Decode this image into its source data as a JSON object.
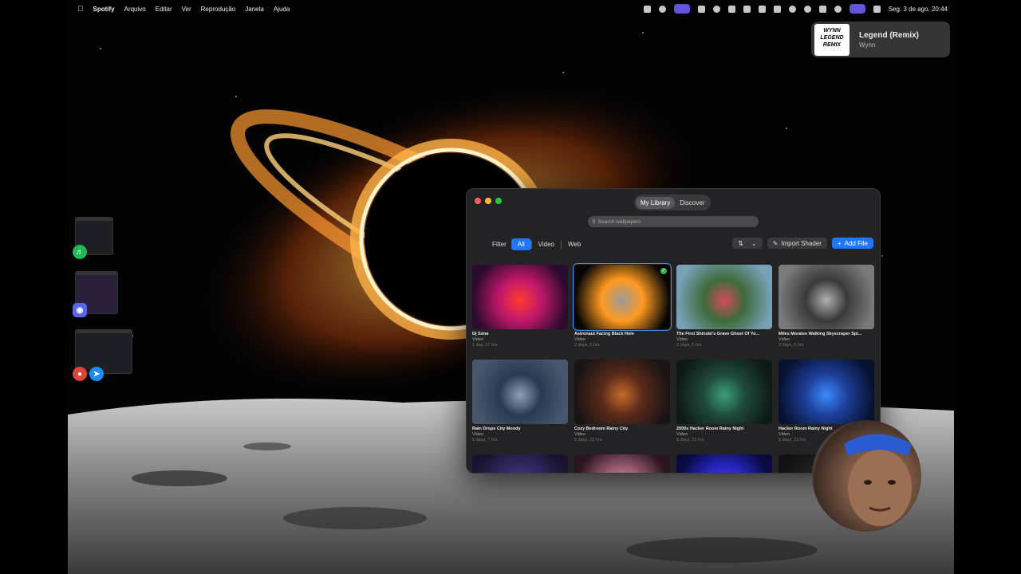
{
  "menubar": {
    "app_name": "Spotify",
    "menus": [
      "Arquivo",
      "Editar",
      "Ver",
      "Reprodução",
      "Janela",
      "Ajuda"
    ],
    "datetime": "Seg. 3 de ago.  20:44"
  },
  "now_playing": {
    "art_text": "WYNN LEGEND REMIX",
    "title": "Legend (Remix)",
    "artist": "Wynn"
  },
  "window": {
    "tabs": [
      "My Library",
      "Discover"
    ],
    "active_tab": "My Library",
    "search_placeholder": "Search wallpapers",
    "filter_label": "Filter",
    "filters": [
      "All",
      "Video",
      "Web"
    ],
    "active_filter": "All",
    "import_label": "Import Shader",
    "add_label": "Add File",
    "cards": [
      {
        "title": "Dj Sona",
        "type": "Video",
        "date": "1 day, 17 hrs",
        "colors": [
          "#2a0a2e",
          "#c2186b",
          "#ff3b2f"
        ]
      },
      {
        "title": "Astronaut Facing Black Hole",
        "type": "Video",
        "date": "2 days, 5 hrs",
        "selected": true,
        "colors": [
          "#050505",
          "#ff9a20",
          "#9a9a9a"
        ]
      },
      {
        "title": "The First Shinobi's Grave Ghost Of Yo...",
        "type": "Video",
        "date": "2 days, 5 hrs",
        "colors": [
          "#7aa0b8",
          "#3e6b3a",
          "#d24b5a"
        ]
      },
      {
        "title": "Miles Morales Walking Skyscraper Spi...",
        "type": "Video",
        "date": "2 days, 5 hrs",
        "colors": [
          "#7a7a7a",
          "#3a3a3a",
          "#b0b0b0"
        ]
      },
      {
        "title": "Rain Drops City Moody",
        "type": "Video",
        "date": "5 days, 7 hrs",
        "colors": [
          "#47586e",
          "#2b3a52",
          "#8ea0b8"
        ]
      },
      {
        "title": "Cozy Bedroom Rainy City",
        "type": "Video",
        "date": "5 days, 21 hrs",
        "colors": [
          "#1a1414",
          "#5a2a1a",
          "#c86a2a"
        ]
      },
      {
        "title": "2000s Hacker Room Rainy Night",
        "type": "Video",
        "date": "5 days, 21 hrs",
        "colors": [
          "#0e1a16",
          "#1f4a3a",
          "#3aa07a"
        ]
      },
      {
        "title": "Hacker Room Rainy Night",
        "type": "Video",
        "date": "5 days, 21 hrs",
        "colors": [
          "#061230",
          "#1e3f9a",
          "#3a8cff"
        ]
      },
      {
        "title": "",
        "type": "",
        "date": "",
        "colors": [
          "#1a1230",
          "#3a2a6a",
          "#6a5acf"
        ]
      },
      {
        "title": "",
        "type": "",
        "date": "",
        "colors": [
          "#2a1420",
          "#a0607a",
          "#e0b0c0"
        ]
      },
      {
        "title": "",
        "type": "",
        "date": "",
        "colors": [
          "#080a40",
          "#2a2acf",
          "#5a5aff"
        ]
      },
      {
        "title": "",
        "type": "",
        "date": "",
        "colors": [
          "#111",
          "#222",
          "#333"
        ]
      }
    ]
  },
  "dock_apps": [
    {
      "name": "spotify-icon",
      "color": "#1db954"
    },
    {
      "name": "discord-icon",
      "color": "#5865f2"
    },
    {
      "name": "chrome-icon",
      "color": "#db4437"
    },
    {
      "name": "safari-icon",
      "color": "#1a8cff"
    }
  ]
}
